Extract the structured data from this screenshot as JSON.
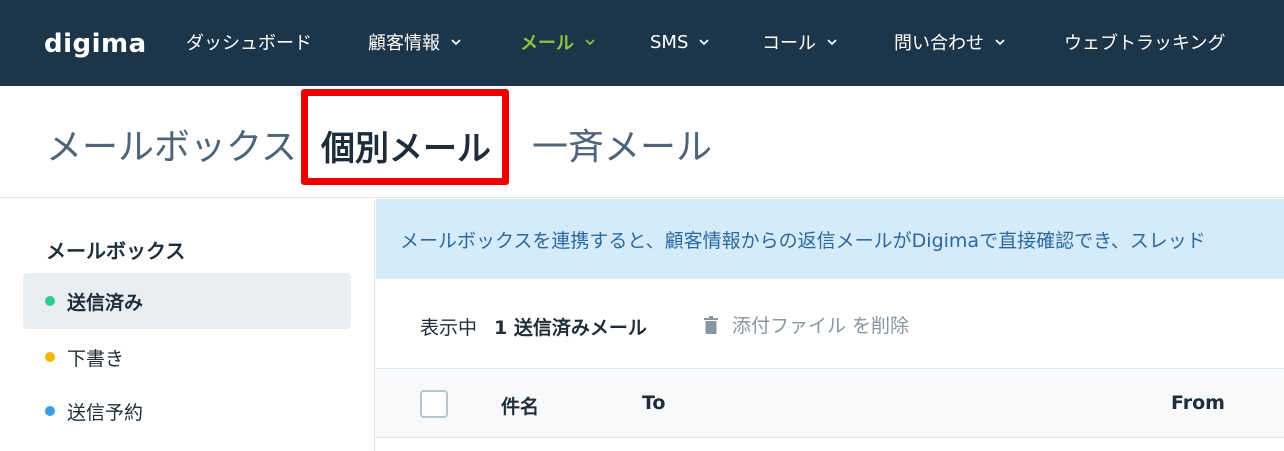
{
  "app": {
    "logo_text": "digima",
    "brand_color": "#8dc63f",
    "nav_bg": "#1d3549"
  },
  "nav": {
    "dashboard": "ダッシュボード",
    "customers": "顧客情報",
    "mail": "メール",
    "sms": "SMS",
    "call": "コール",
    "inquiry": "問い合わせ",
    "web_tracking": "ウェブトラッキング"
  },
  "tabs": {
    "mailbox": "メールボックス",
    "individual": "個別メール",
    "bulk": "一斉メール"
  },
  "sidebar": {
    "heading": "メールボックス",
    "items": [
      {
        "label": "送信済み",
        "dot_color": "#2ecc8f"
      },
      {
        "label": "下書き",
        "dot_color": "#f5b800"
      },
      {
        "label": "送信予約",
        "dot_color": "#3c9ce8"
      }
    ]
  },
  "banner": {
    "text": "メールボックスを連携すると、顧客情報からの返信メールがDigimaで直接確認でき、スレッド"
  },
  "toolbar": {
    "showing_label": "表示中",
    "showing_value": "1 送信済みメール",
    "delete_attachments": "添付ファイル を削除"
  },
  "table": {
    "columns": [
      "件名",
      "To",
      "From"
    ]
  }
}
